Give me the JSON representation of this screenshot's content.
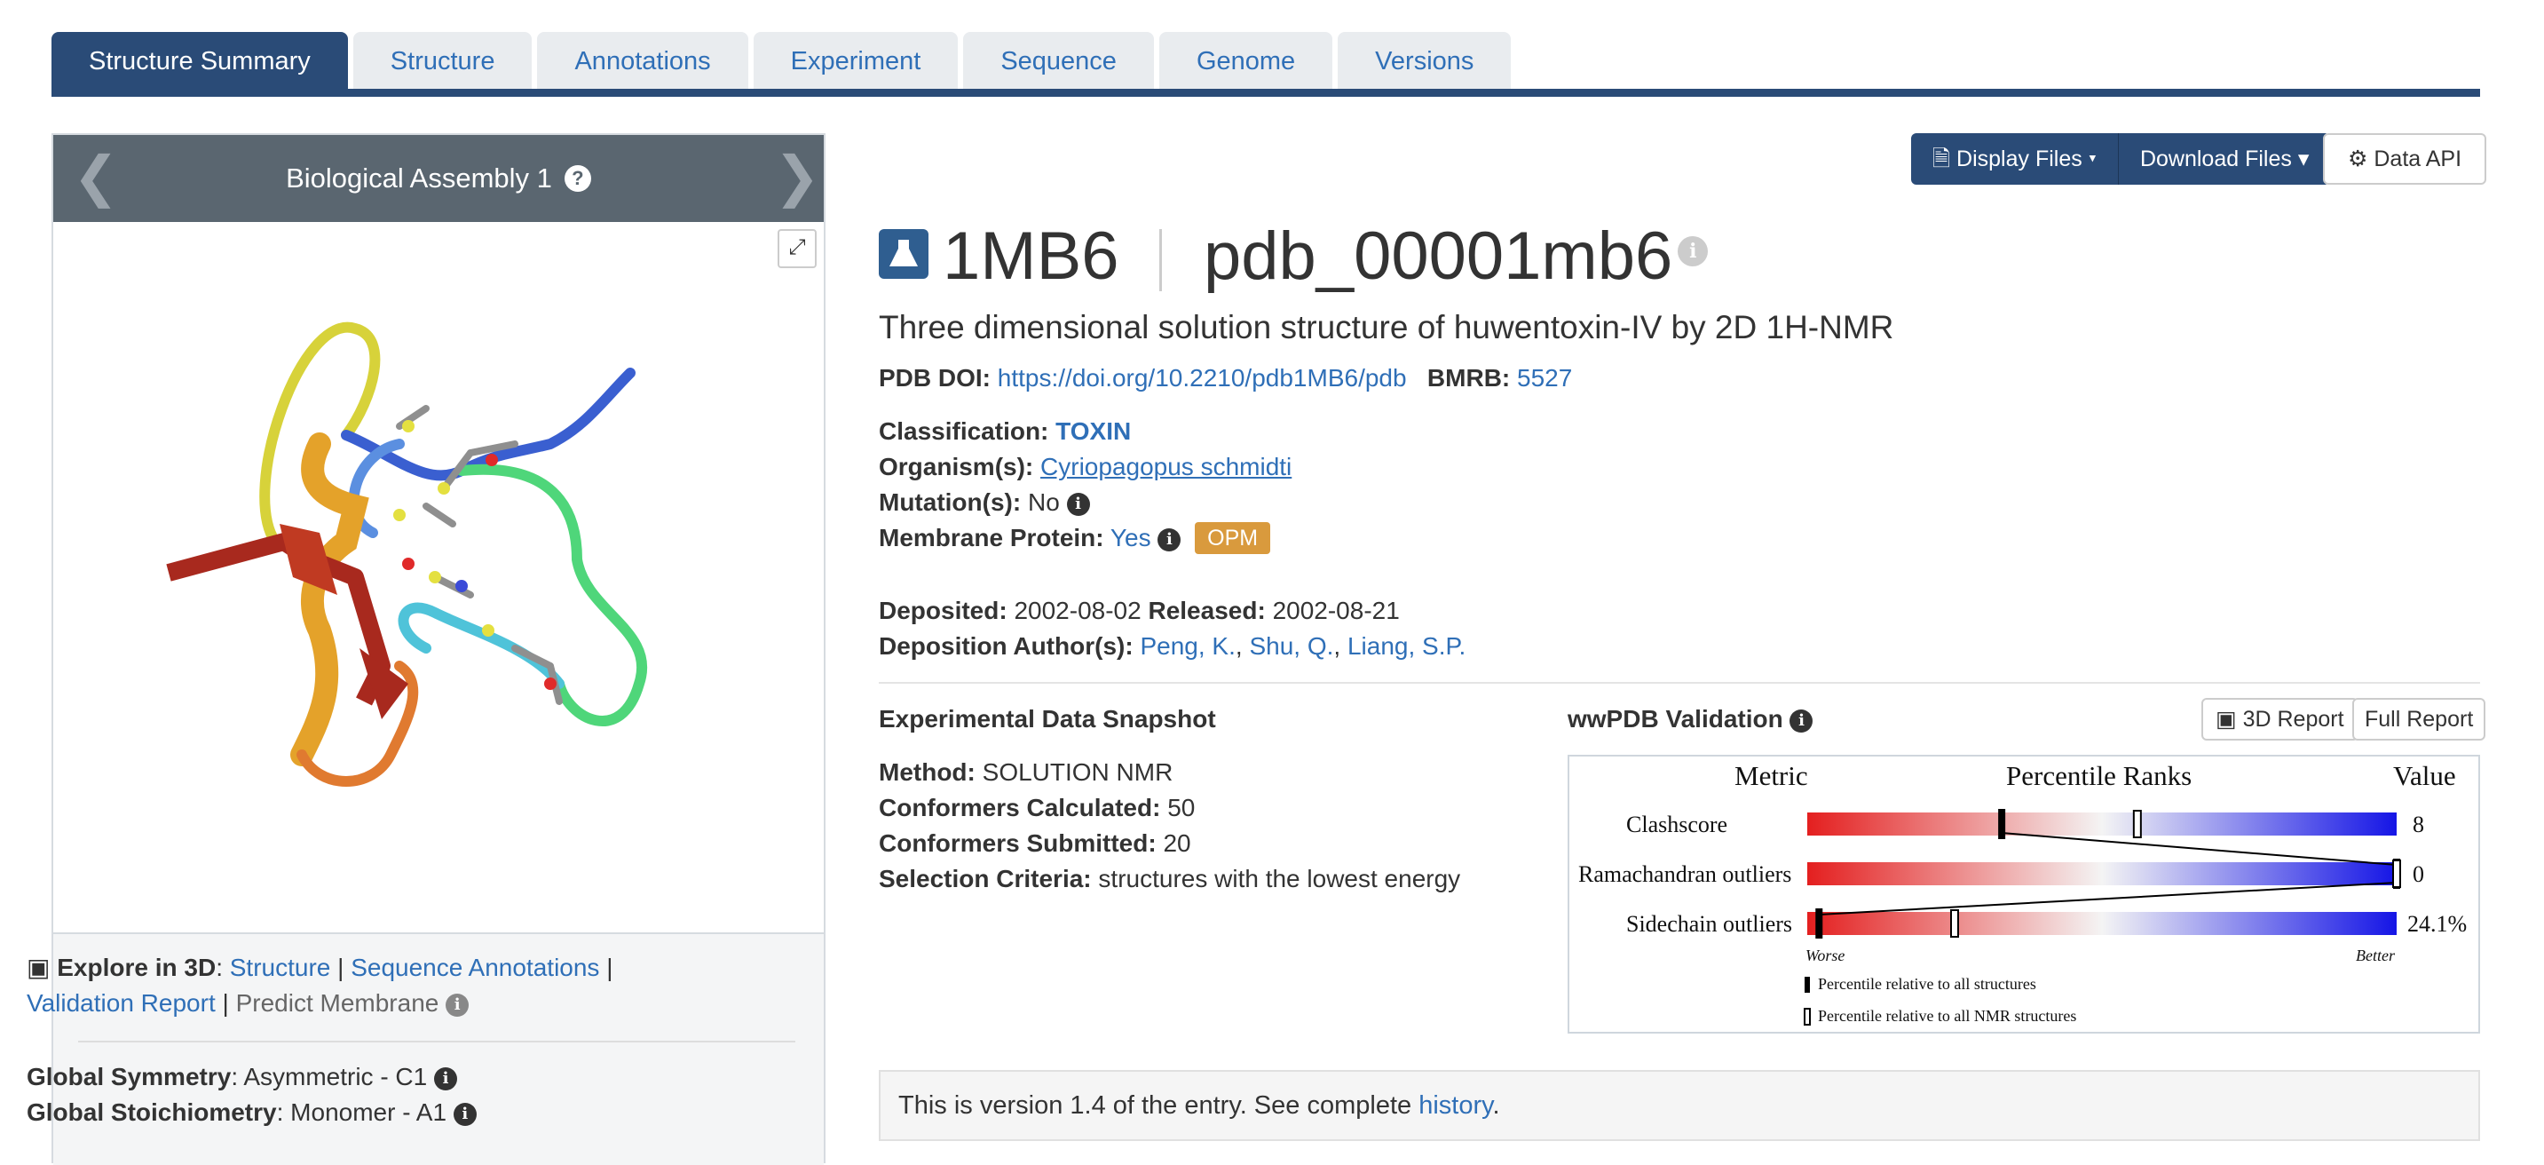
{
  "tabs": [
    {
      "label": "Structure Summary",
      "active": true
    },
    {
      "label": "Structure"
    },
    {
      "label": "Annotations"
    },
    {
      "label": "Experiment"
    },
    {
      "label": "Sequence"
    },
    {
      "label": "Genome"
    },
    {
      "label": "Versions"
    }
  ],
  "assembly": {
    "title": "Biological Assembly 1"
  },
  "explore": {
    "label": "Explore in 3D",
    "links": [
      "Structure",
      "Sequence Annotations",
      "Validation Report"
    ],
    "predict": "Predict Membrane"
  },
  "symmetry": {
    "sym_label": "Global Symmetry",
    "sym_value": "Asymmetric - C1",
    "stoich_label": "Global Stoichiometry",
    "stoich_value": "Monomer - A1"
  },
  "buttons": {
    "display_files": "Display Files",
    "download_files": "Download Files",
    "data_api": "Data API"
  },
  "entry": {
    "id": "1MB6",
    "pdb_id": "pdb_00001mb6",
    "title": "Three dimensional solution structure of huwentoxin-IV by 2D 1H-NMR",
    "doi_label": "PDB DOI:",
    "doi": "https://doi.org/10.2210/pdb1MB6/pdb",
    "bmrb_label": "BMRB:",
    "bmrb": "5527",
    "classification_label": "Classification:",
    "classification": "TOXIN",
    "organism_label": "Organism(s):",
    "organism": "Cyriopagopus schmidti",
    "mutation_label": "Mutation(s):",
    "mutation": "No",
    "membrane_label": "Membrane Protein:",
    "membrane": "Yes",
    "membrane_badge": "OPM",
    "deposited_label": "Deposited:",
    "deposited": "2002-08-02",
    "released_label": "Released:",
    "released": "2002-08-21",
    "authors_label": "Deposition Author(s):",
    "authors": [
      "Peng, K.",
      "Shu, Q.",
      "Liang, S.P."
    ]
  },
  "snapshot": {
    "title": "Experimental Data Snapshot",
    "method_label": "Method:",
    "method": "SOLUTION NMR",
    "calc_label": "Conformers Calculated:",
    "calc": "50",
    "sub_label": "Conformers Submitted:",
    "sub": "20",
    "criteria_label": "Selection Criteria:",
    "criteria": "structures with the lowest energy"
  },
  "validation": {
    "title": "wwPDB Validation",
    "report_3d": "3D Report",
    "full_report": "Full Report",
    "header_metric": "Metric",
    "header_ranks": "Percentile Ranks",
    "header_value": "Value",
    "worse": "Worse",
    "better": "Better",
    "legend_all": "Percentile relative to all structures",
    "legend_nmr": "Percentile relative to all NMR structures",
    "metrics": [
      {
        "name": "Clashscore",
        "value": "8",
        "pct_all": 33,
        "pct_nmr": 56
      },
      {
        "name": "Ramachandran outliers",
        "value": "0",
        "pct_all": 100,
        "pct_nmr": 100
      },
      {
        "name": "Sidechain outliers",
        "value": "24.1%",
        "pct_all": 2,
        "pct_nmr": 25
      }
    ]
  },
  "version": {
    "text": "This is version 1.4 of the entry. See complete",
    "link": "history",
    "end": "."
  }
}
